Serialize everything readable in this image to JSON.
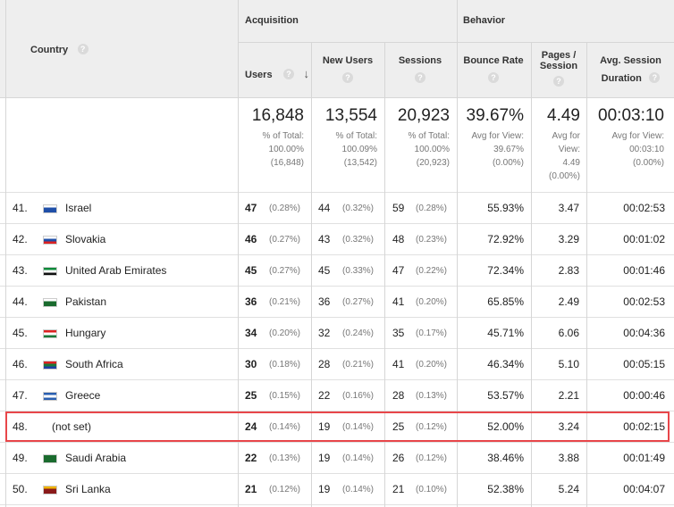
{
  "header": {
    "country": "Country",
    "acquisition": "Acquisition",
    "behavior": "Behavior",
    "users": "Users",
    "new_users": "New Users",
    "sessions": "Sessions",
    "bounce_rate": "Bounce Rate",
    "pages_session_1": "Pages /",
    "pages_session_2": "Session",
    "avg_duration_1": "Avg. Session",
    "avg_duration_2": "Duration",
    "help_icon": "?",
    "sort_icon": "arrow-down-icon"
  },
  "totals": {
    "users": {
      "value": "16,848",
      "l1": "% of Total:",
      "l2": "100.00%",
      "l3": "(16,848)"
    },
    "new_users": {
      "value": "13,554",
      "l1": "% of Total:",
      "l2": "100.09%",
      "l3": "(13,542)"
    },
    "sessions": {
      "value": "20,923",
      "l1": "% of Total:",
      "l2": "100.00%",
      "l3": "(20,923)"
    },
    "bounce_rate": {
      "value": "39.67%",
      "l1": "Avg for View:",
      "l2": "39.67%",
      "l3": "(0.00%)"
    },
    "pages_session": {
      "value": "4.49",
      "l1": "Avg for",
      "l2": "View:",
      "l3": "4.49",
      "l4": "(0.00%)"
    },
    "avg_duration": {
      "value": "00:03:10",
      "l1": "Avg for View:",
      "l2": "00:03:10",
      "l3": "(0.00%)"
    }
  },
  "rows": [
    {
      "idx": "41.",
      "country": "Israel",
      "flag": [
        "#fff",
        "#1f4fa8"
      ],
      "users": "47",
      "users_pct": "(0.28%)",
      "new_users": "44",
      "new_pct": "(0.32%)",
      "sessions": "59",
      "sess_pct": "(0.28%)",
      "bounce": "55.93%",
      "pages": "3.47",
      "duration": "00:02:53"
    },
    {
      "idx": "42.",
      "country": "Slovakia",
      "flag": [
        "#fff",
        "#1f4fa8",
        "#d22"
      ],
      "users": "46",
      "users_pct": "(0.27%)",
      "new_users": "43",
      "new_pct": "(0.32%)",
      "sessions": "48",
      "sess_pct": "(0.23%)",
      "bounce": "72.92%",
      "pages": "3.29",
      "duration": "00:01:02"
    },
    {
      "idx": "43.",
      "country": "United Arab Emirates",
      "flag": [
        "#0a8a3a",
        "#fff",
        "#111"
      ],
      "users": "45",
      "users_pct": "(0.27%)",
      "new_users": "45",
      "new_pct": "(0.33%)",
      "sessions": "47",
      "sess_pct": "(0.22%)",
      "bounce": "72.34%",
      "pages": "2.83",
      "duration": "00:01:46"
    },
    {
      "idx": "44.",
      "country": "Pakistan",
      "flag": [
        "#fff",
        "#1a6b2e",
        "#1a6b2e"
      ],
      "users": "36",
      "users_pct": "(0.21%)",
      "new_users": "36",
      "new_pct": "(0.27%)",
      "sessions": "41",
      "sess_pct": "(0.20%)",
      "bounce": "65.85%",
      "pages": "2.49",
      "duration": "00:02:53"
    },
    {
      "idx": "45.",
      "country": "Hungary",
      "flag": [
        "#d22",
        "#fff",
        "#1a7a3a"
      ],
      "users": "34",
      "users_pct": "(0.20%)",
      "new_users": "32",
      "new_pct": "(0.24%)",
      "sessions": "35",
      "sess_pct": "(0.17%)",
      "bounce": "45.71%",
      "pages": "6.06",
      "duration": "00:04:36"
    },
    {
      "idx": "46.",
      "country": "South Africa",
      "flag": [
        "#d22",
        "#1a7a3a",
        "#1f3fa8"
      ],
      "users": "30",
      "users_pct": "(0.18%)",
      "new_users": "28",
      "new_pct": "(0.21%)",
      "sessions": "41",
      "sess_pct": "(0.20%)",
      "bounce": "46.34%",
      "pages": "5.10",
      "duration": "00:05:15"
    },
    {
      "idx": "47.",
      "country": "Greece",
      "flag": [
        "#2a5fb0",
        "#fff",
        "#2a5fb0"
      ],
      "users": "25",
      "users_pct": "(0.15%)",
      "new_users": "22",
      "new_pct": "(0.16%)",
      "sessions": "28",
      "sess_pct": "(0.13%)",
      "bounce": "53.57%",
      "pages": "2.21",
      "duration": "00:00:46"
    },
    {
      "idx": "48.",
      "country": "(not set)",
      "flag": [],
      "users": "24",
      "users_pct": "(0.14%)",
      "new_users": "19",
      "new_pct": "(0.14%)",
      "sessions": "25",
      "sess_pct": "(0.12%)",
      "bounce": "52.00%",
      "pages": "3.24",
      "duration": "00:02:15"
    },
    {
      "idx": "49.",
      "country": "Saudi Arabia",
      "flag": [
        "#1a6b2e",
        "#1a6b2e",
        "#1a6b2e"
      ],
      "users": "22",
      "users_pct": "(0.13%)",
      "new_users": "19",
      "new_pct": "(0.14%)",
      "sessions": "26",
      "sess_pct": "(0.12%)",
      "bounce": "38.46%",
      "pages": "3.88",
      "duration": "00:01:49"
    },
    {
      "idx": "50.",
      "country": "Sri Lanka",
      "flag": [
        "#f0b400",
        "#8a1a1a",
        "#8a1a1a"
      ],
      "users": "21",
      "users_pct": "(0.12%)",
      "new_users": "19",
      "new_pct": "(0.14%)",
      "sessions": "21",
      "sess_pct": "(0.10%)",
      "bounce": "52.38%",
      "pages": "5.24",
      "duration": "00:04:07"
    }
  ],
  "highlight_color": "#e8464a"
}
